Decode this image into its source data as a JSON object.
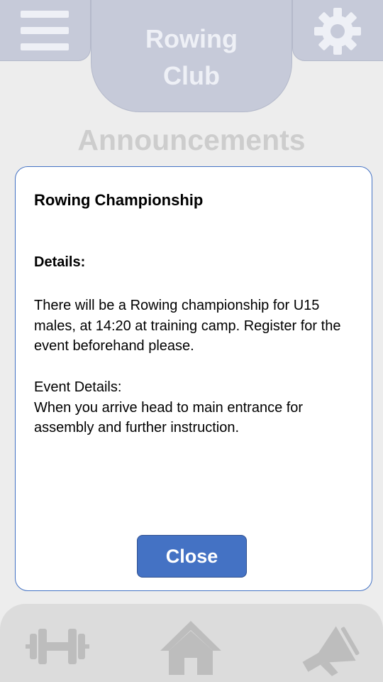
{
  "header": {
    "title_line1": "Rowing",
    "title_line2": "Club"
  },
  "section": {
    "title": "Announcements"
  },
  "dialog": {
    "title": "Rowing Championship",
    "details_label": "Details:",
    "body": "There will be a Rowing championship for U15 males, at 14:20 at training camp. Register for the event beforehand please.",
    "event_details_label": "Event Details:",
    "event_details_text": "When you arrive head to main entrance for assembly and further instruction.",
    "close_label": "Close"
  },
  "icons": {
    "menu": "hamburger-menu-icon",
    "settings": "gear-icon",
    "nav_workouts": "dumbbell-icon",
    "nav_home": "home-icon",
    "nav_announcements": "megaphone-icon"
  },
  "colors": {
    "header_fill": "#c6cad9",
    "header_text": "#eef0f6",
    "background": "#ededed",
    "accent": "#4472c4",
    "nav_fill": "#dcdcdc",
    "nav_icon": "#bdbdbd",
    "section_title": "#cdcdcd"
  }
}
